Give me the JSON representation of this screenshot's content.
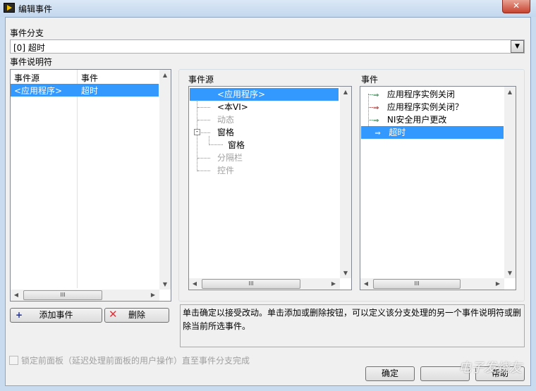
{
  "window": {
    "title": "编辑事件",
    "close": "✕"
  },
  "case": {
    "label": "事件分支",
    "value": "[0] 超时"
  },
  "specifiers": {
    "label": "事件说明符",
    "columns": [
      "事件源",
      "事件"
    ],
    "rows": [
      {
        "source": "<应用程序>",
        "event": "超时"
      }
    ]
  },
  "sources": {
    "label": "事件源",
    "items": [
      {
        "label": "<应用程序>",
        "state": "selected"
      },
      {
        "label": "<本VI>",
        "state": "normal"
      },
      {
        "label": "动态",
        "state": "disabled"
      },
      {
        "label": "窗格",
        "state": "normal"
      },
      {
        "label": "窗格",
        "state": "normal"
      },
      {
        "label": "分隔栏",
        "state": "disabled"
      },
      {
        "label": "控件",
        "state": "disabled"
      }
    ]
  },
  "events": {
    "label": "事件",
    "items": [
      {
        "label": "应用程序实例关闭",
        "arrow": "#1a7a3a"
      },
      {
        "label": "应用程序实例关闭？",
        "arrow": "#a01010"
      },
      {
        "label": "NI安全用户更改",
        "arrow": "#1a7a3a"
      },
      {
        "label": "超时",
        "arrow": "#1a7a3a"
      }
    ]
  },
  "buttons": {
    "add": "添加事件",
    "delete": "删除",
    "ok": "确定",
    "cancel": "",
    "help": "帮助"
  },
  "description": "单击确定以接受改动。单击添加或删除按钮，可以定义该分支处理的另一个事件说明符或删除当前所选事件。",
  "lock_checkbox": {
    "label": "锁定前面板（延迟处理前面板的用户操作）直至事件分支完成",
    "checked": false
  },
  "scroll": {
    "thumb": "III",
    "up": "▲",
    "down": "▼",
    "left": "◀",
    "right": "▶"
  },
  "watermark": "电子发烧友"
}
